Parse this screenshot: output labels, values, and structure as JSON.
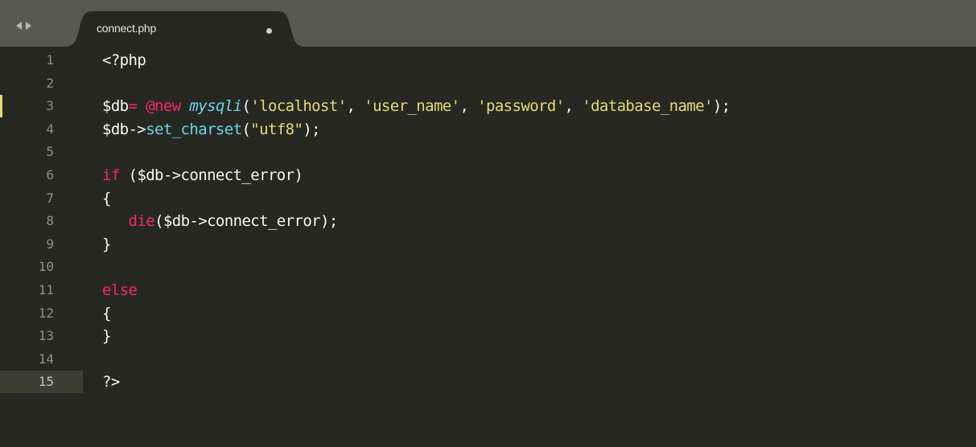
{
  "tab": {
    "filename": "connect.php",
    "modified": true
  },
  "lines": [
    {
      "num": "1",
      "tokens": [
        {
          "t": "<?php",
          "c": "pl"
        }
      ]
    },
    {
      "num": "2",
      "tokens": []
    },
    {
      "num": "3",
      "modified": true,
      "tokens": [
        {
          "t": "$db",
          "c": "pl"
        },
        {
          "t": "=",
          "c": "kw"
        },
        {
          "t": " ",
          "c": "pl"
        },
        {
          "t": "@new",
          "c": "kw"
        },
        {
          "t": " ",
          "c": "pl"
        },
        {
          "t": "mysqli",
          "c": "cls"
        },
        {
          "t": "(",
          "c": "pl"
        },
        {
          "t": "'localhost'",
          "c": "str"
        },
        {
          "t": ", ",
          "c": "pl"
        },
        {
          "t": "'user_name'",
          "c": "str"
        },
        {
          "t": ", ",
          "c": "pl"
        },
        {
          "t": "'password'",
          "c": "str"
        },
        {
          "t": ", ",
          "c": "pl"
        },
        {
          "t": "'database_name'",
          "c": "str"
        },
        {
          "t": ");",
          "c": "pl"
        }
      ]
    },
    {
      "num": "4",
      "tokens": [
        {
          "t": "$db->",
          "c": "pl"
        },
        {
          "t": "set_charset",
          "c": "fn"
        },
        {
          "t": "(",
          "c": "pl"
        },
        {
          "t": "\"utf8\"",
          "c": "str"
        },
        {
          "t": ");",
          "c": "pl"
        }
      ]
    },
    {
      "num": "5",
      "tokens": []
    },
    {
      "num": "6",
      "tokens": [
        {
          "t": "if",
          "c": "kw"
        },
        {
          "t": " ($db->connect_error)",
          "c": "pl"
        }
      ]
    },
    {
      "num": "7",
      "tokens": [
        {
          "t": "{",
          "c": "pl"
        }
      ]
    },
    {
      "num": "8",
      "tokens": [
        {
          "t": "   ",
          "c": "pl"
        },
        {
          "t": "die",
          "c": "kw"
        },
        {
          "t": "($db->connect_error);",
          "c": "pl"
        }
      ]
    },
    {
      "num": "9",
      "tokens": [
        {
          "t": "}",
          "c": "pl"
        }
      ]
    },
    {
      "num": "10",
      "tokens": []
    },
    {
      "num": "11",
      "tokens": [
        {
          "t": "else",
          "c": "kw"
        }
      ]
    },
    {
      "num": "12",
      "tokens": [
        {
          "t": "{",
          "c": "pl"
        }
      ]
    },
    {
      "num": "13",
      "tokens": [
        {
          "t": "}",
          "c": "pl"
        }
      ]
    },
    {
      "num": "14",
      "tokens": []
    },
    {
      "num": "15",
      "active": true,
      "tokens": [
        {
          "t": "?>",
          "c": "pl"
        }
      ]
    }
  ],
  "colors": {
    "background": "#272822",
    "tabbar": "#585953",
    "keyword": "#f92672",
    "function": "#66d9ef",
    "string": "#e6db74",
    "plain": "#f8f8f2",
    "gutter_text": "#90908a",
    "modified_marker": "#e6db74"
  }
}
